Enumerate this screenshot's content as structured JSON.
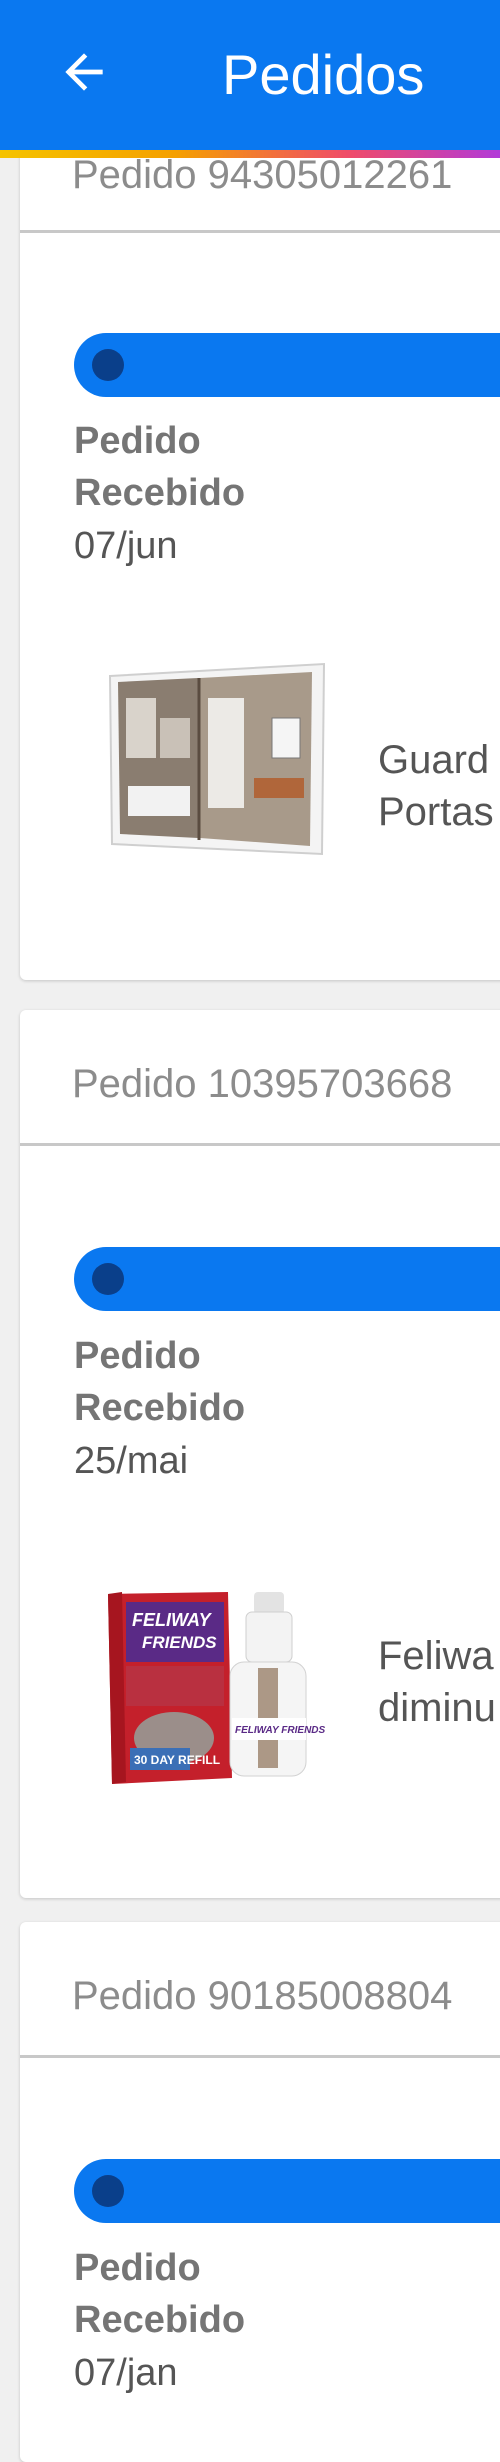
{
  "appbar": {
    "title": "Pedidos",
    "back_icon": "arrow-left-icon",
    "color": "#0a78f0"
  },
  "orders": [
    {
      "number": "Pedido 94305012261",
      "status": "Pedido Recebido",
      "date": "07/jun",
      "product_name": "Guard\nPortas",
      "product_icon": "wardrobe-image"
    },
    {
      "number": "Pedido 10395703668",
      "status": "Pedido Recebido",
      "date": "25/mai",
      "product_name": "Feliwa\ndiminu",
      "product_icon": "feliway-refill-image"
    },
    {
      "number": "Pedido 90185008804",
      "status": "Pedido Recebido",
      "date": "07/jan"
    }
  ],
  "colors": {
    "accent": "#0a78f0",
    "progress_dot": "#0a3f8a",
    "muted_text": "#8c8c8c",
    "background": "#f0f0f0"
  }
}
